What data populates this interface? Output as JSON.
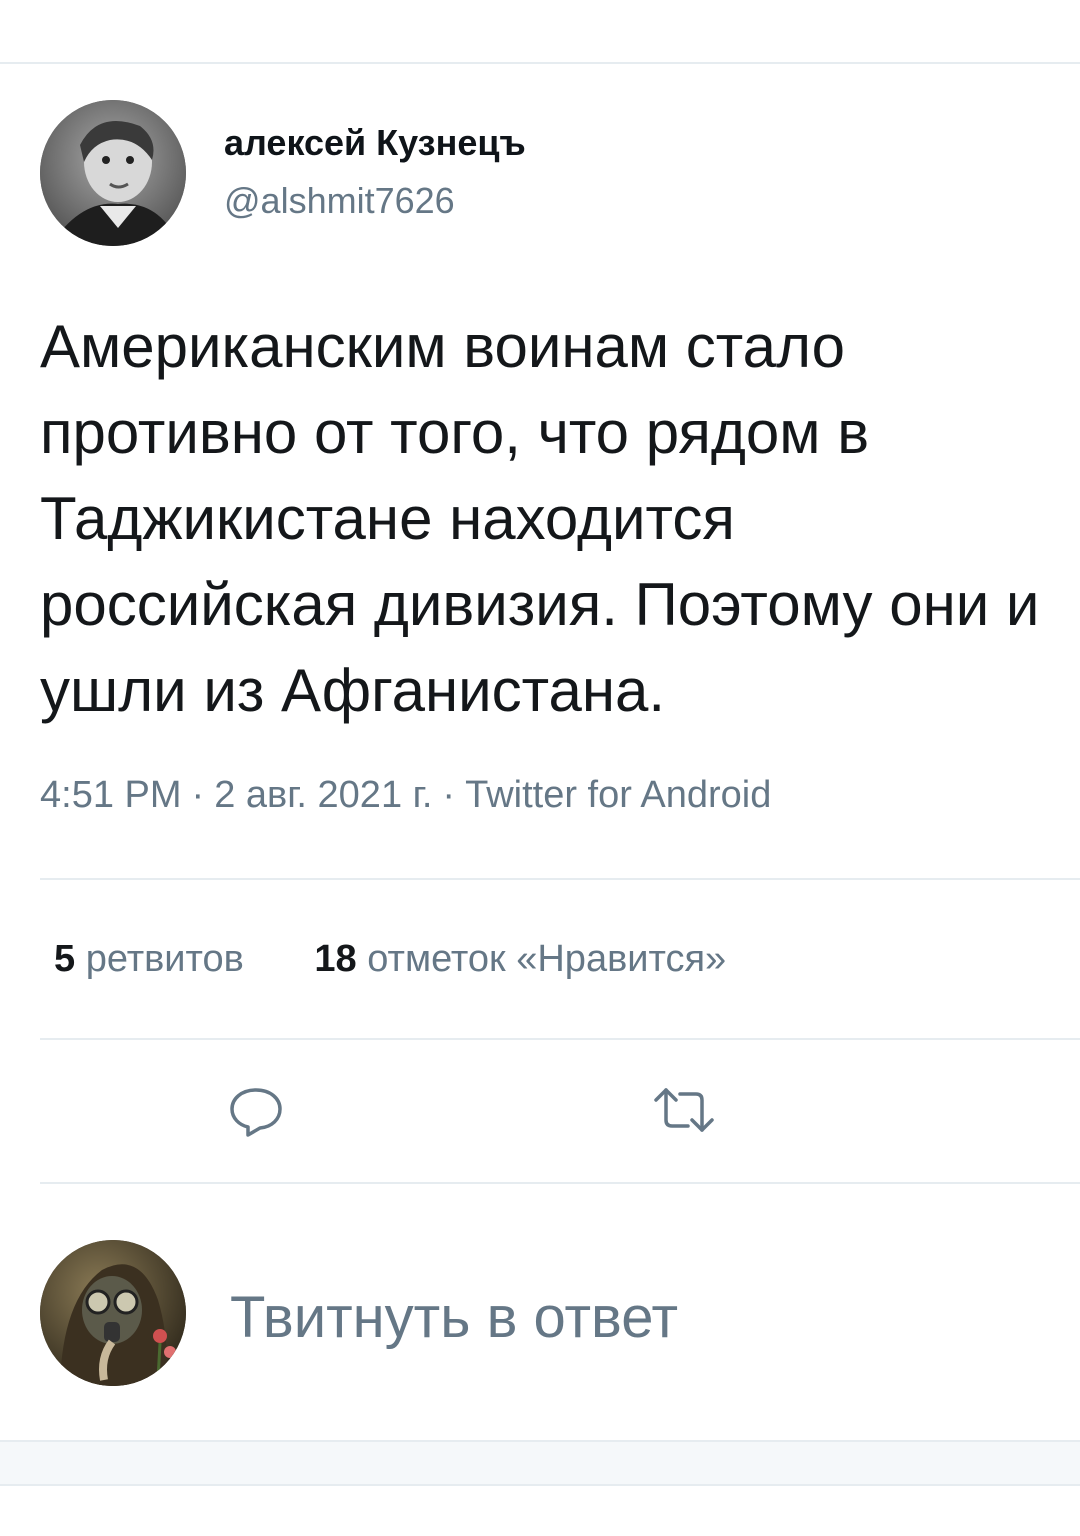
{
  "tweet": {
    "author": {
      "display_name": "алексей Кузнецъ",
      "handle": "@alshmit7626"
    },
    "text": "Американским воинам стало противно от того, что рядом в Таджикистане находится российская дивизия. Поэтому они и ушли из Афганистана.",
    "time": "4:51 PM",
    "date": "2 авг. 2021 г.",
    "source": "Twitter for Android",
    "separator": "·"
  },
  "stats": {
    "retweets_count": "5",
    "retweets_label": "ретвитов",
    "likes_count": "18",
    "likes_label": "отметок «Нравится»"
  },
  "actions": {
    "reply_icon": "reply-icon",
    "retweet_icon": "retweet-icon"
  },
  "reply": {
    "placeholder": "Твитнуть в ответ"
  },
  "colors": {
    "text_primary": "#14171a",
    "text_secondary": "#657786",
    "divider": "#e6ecf0"
  }
}
